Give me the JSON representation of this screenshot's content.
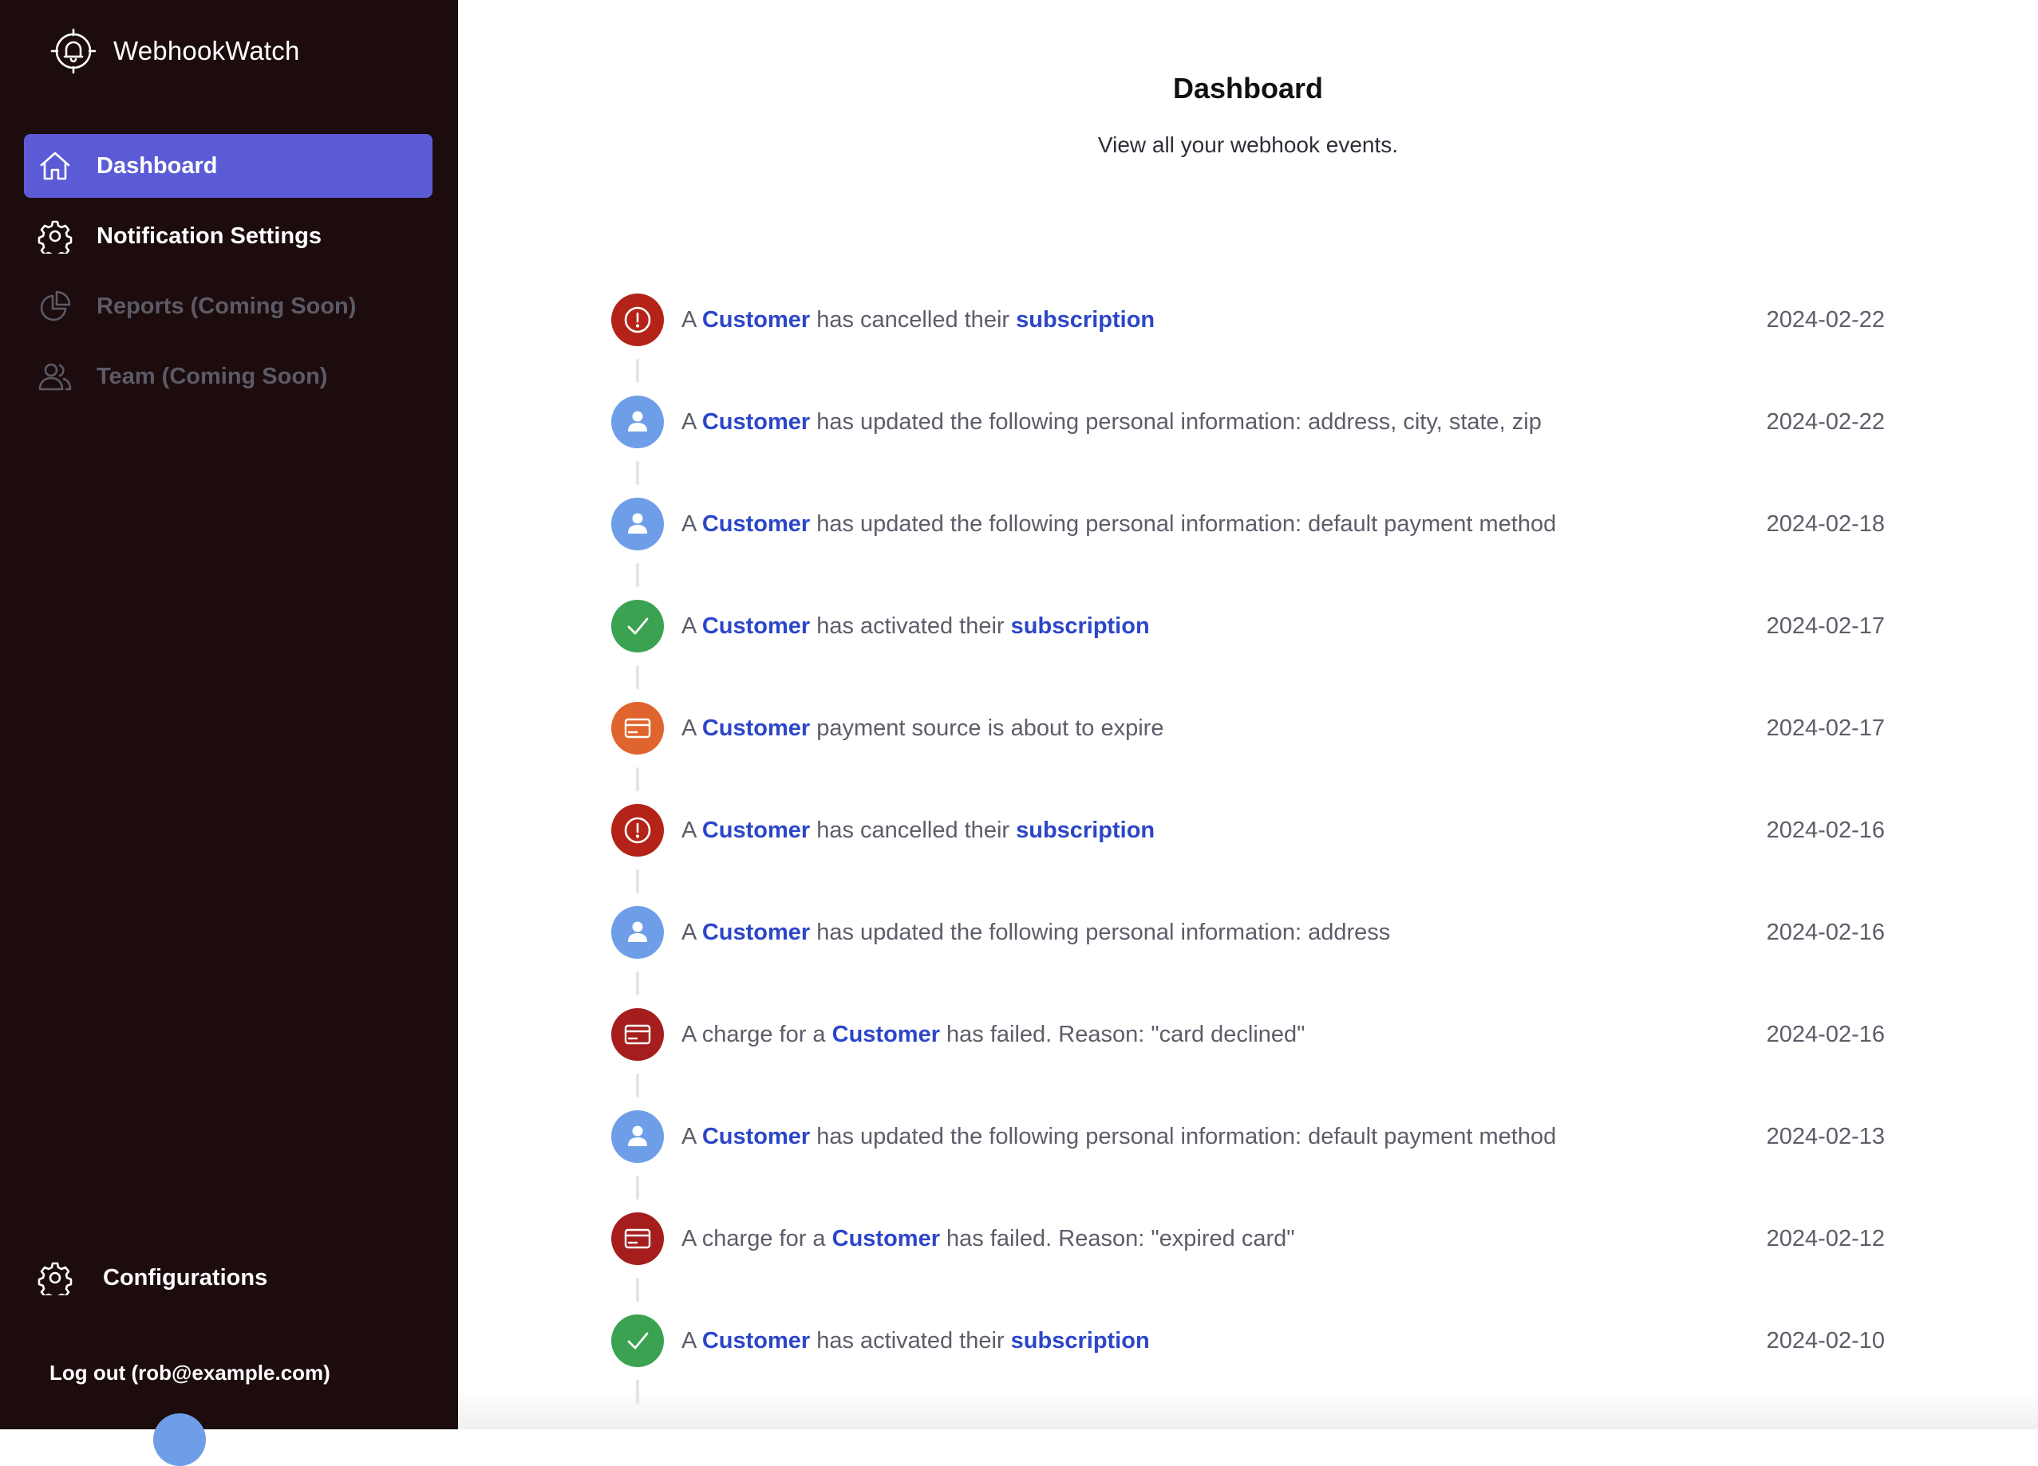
{
  "app": {
    "name": "WebhookWatch",
    "logo_icon": "bell-crosshair-icon"
  },
  "sidebar": {
    "items": [
      {
        "label": "Dashboard",
        "icon": "home-icon",
        "state": "active"
      },
      {
        "label": "Notification Settings",
        "icon": "gear-icon",
        "state": "enabled"
      },
      {
        "label": "Reports (Coming Soon)",
        "icon": "pie-chart-icon",
        "state": "disabled"
      },
      {
        "label": "Team (Coming Soon)",
        "icon": "users-icon",
        "state": "disabled"
      }
    ],
    "configurations": {
      "label": "Configurations",
      "icon": "gear-icon"
    },
    "logout_label": "Log out (rob@example.com)"
  },
  "main": {
    "title": "Dashboard",
    "subtitle": "View all your webhook events."
  },
  "events": [
    {
      "type": "cancelled",
      "icon": "alert-circle-icon",
      "color": "#b42318",
      "parts": [
        "A ",
        {
          "link": "Customer"
        },
        " has cancelled their ",
        {
          "link": "subscription"
        }
      ],
      "date": "2024-02-22"
    },
    {
      "type": "updated",
      "icon": "user-icon",
      "color": "#6f9ee8",
      "parts": [
        "A ",
        {
          "link": "Customer"
        },
        " has updated the following personal information: address, city, state, zip"
      ],
      "date": "2024-02-22"
    },
    {
      "type": "updated",
      "icon": "user-icon",
      "color": "#6f9ee8",
      "parts": [
        "A ",
        {
          "link": "Customer"
        },
        " has updated the following personal information: default payment method"
      ],
      "date": "2024-02-18"
    },
    {
      "type": "activated",
      "icon": "check-icon",
      "color": "#3aa251",
      "parts": [
        "A ",
        {
          "link": "Customer"
        },
        " has activated their ",
        {
          "link": "subscription"
        }
      ],
      "date": "2024-02-17"
    },
    {
      "type": "expiring",
      "icon": "credit-card-icon",
      "color": "#e0642d",
      "parts": [
        "A ",
        {
          "link": "Customer"
        },
        " payment source is about to expire"
      ],
      "date": "2024-02-17"
    },
    {
      "type": "cancelled",
      "icon": "alert-circle-icon",
      "color": "#b42318",
      "parts": [
        "A ",
        {
          "link": "Customer"
        },
        " has cancelled their ",
        {
          "link": "subscription"
        }
      ],
      "date": "2024-02-16"
    },
    {
      "type": "updated",
      "icon": "user-icon",
      "color": "#6f9ee8",
      "parts": [
        "A ",
        {
          "link": "Customer"
        },
        " has updated the following personal information: address"
      ],
      "date": "2024-02-16"
    },
    {
      "type": "failed",
      "icon": "credit-card-icon",
      "color": "#a51d1d",
      "parts": [
        "A charge for a ",
        {
          "link": "Customer"
        },
        " has failed. Reason: \"card declined\""
      ],
      "date": "2024-02-16"
    },
    {
      "type": "updated",
      "icon": "user-icon",
      "color": "#6f9ee8",
      "parts": [
        "A ",
        {
          "link": "Customer"
        },
        " has updated the following personal information: default payment method"
      ],
      "date": "2024-02-13"
    },
    {
      "type": "failed",
      "icon": "credit-card-icon",
      "color": "#a51d1d",
      "parts": [
        "A charge for a ",
        {
          "link": "Customer"
        },
        " has failed. Reason: \"expired card\""
      ],
      "date": "2024-02-12"
    },
    {
      "type": "activated",
      "icon": "check-icon",
      "color": "#3aa251",
      "parts": [
        "A ",
        {
          "link": "Customer"
        },
        " has activated their ",
        {
          "link": "subscription"
        }
      ],
      "date": "2024-02-10"
    }
  ],
  "colors": {
    "sidebar_bg": "#1c0c0d",
    "accent": "#5b5bd6",
    "link": "#2c46c9"
  }
}
